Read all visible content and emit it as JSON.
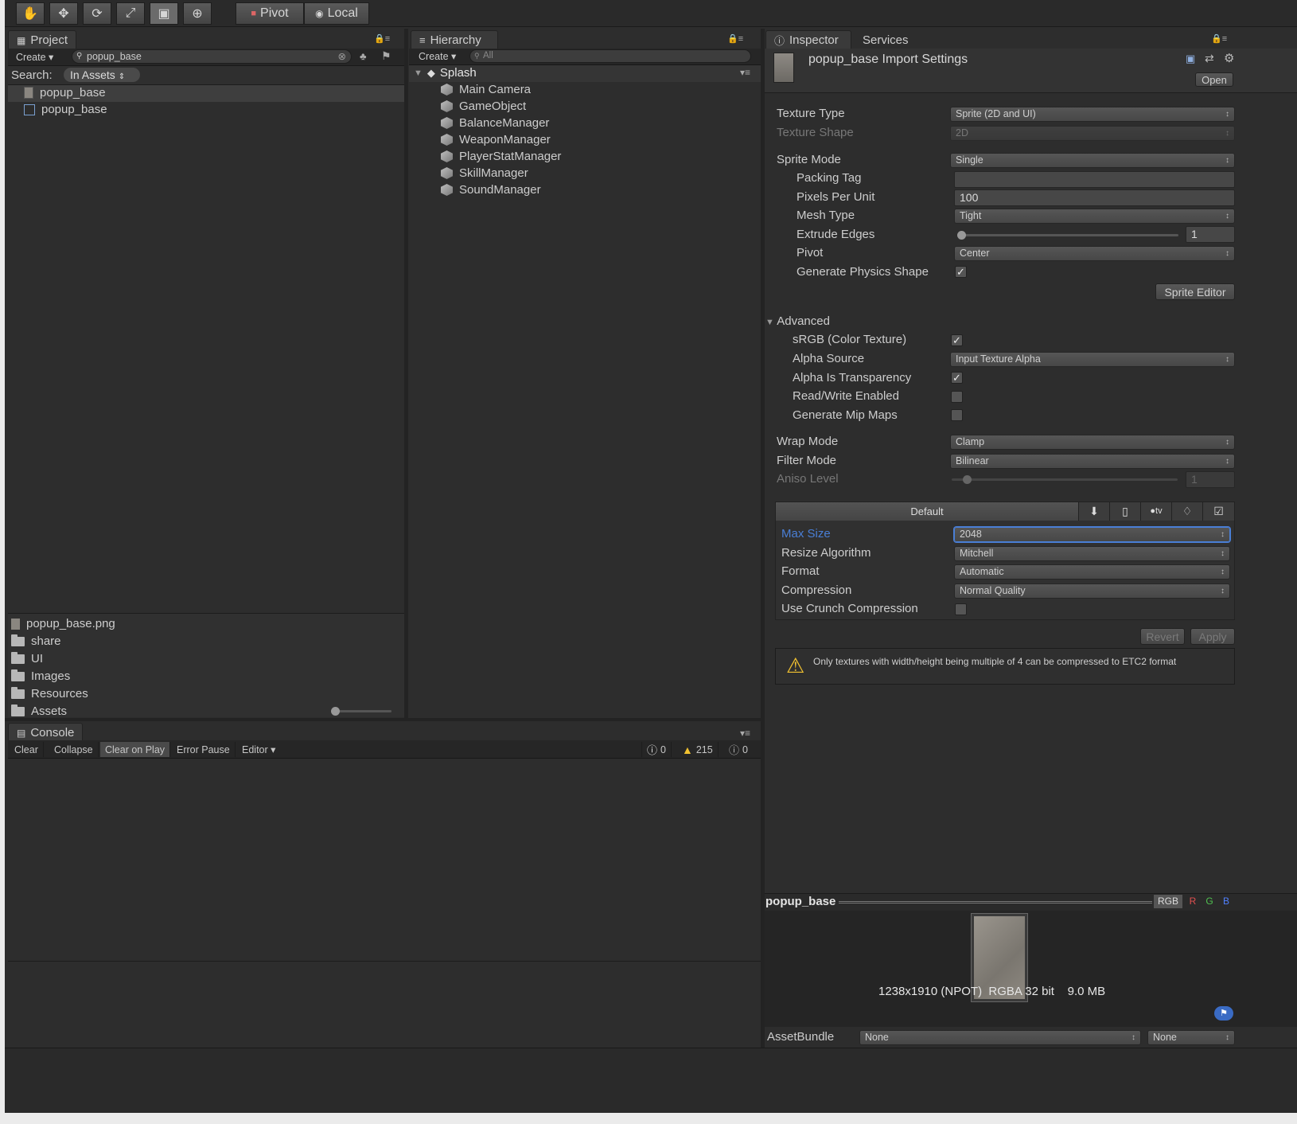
{
  "toolbar": {
    "pivot": "Pivot",
    "local": "Local",
    "tool_icons": [
      "hand-icon",
      "move-icon",
      "rotate-icon",
      "scale-icon",
      "rect-icon",
      "transform-icon"
    ]
  },
  "project": {
    "tab": "Project",
    "create": "Create",
    "search_value": "popup_base",
    "search_label": "Search:",
    "search_scope": "In Assets",
    "results": [
      {
        "name": "popup_base",
        "icon": "texture-icon"
      },
      {
        "name": "popup_base",
        "icon": "sprite-icon"
      }
    ],
    "bottom_items": [
      {
        "name": "popup_base.png",
        "icon": "texture-icon"
      },
      {
        "name": "share",
        "icon": "folder-icon"
      },
      {
        "name": "UI",
        "icon": "folder-icon"
      },
      {
        "name": "Images",
        "icon": "folder-icon"
      },
      {
        "name": "Resources",
        "icon": "folder-icon"
      },
      {
        "name": "Assets",
        "icon": "folder-icon"
      }
    ]
  },
  "hierarchy": {
    "tab": "Hierarchy",
    "create": "Create",
    "search_placeholder": "All",
    "scene": "Splash",
    "objects": [
      "Main Camera",
      "GameObject",
      "BalanceManager",
      "WeaponManager",
      "PlayerStatManager",
      "SkillManager",
      "SoundManager"
    ]
  },
  "inspector": {
    "tab": "Inspector",
    "services_tab": "Services",
    "title": "popup_base Import Settings",
    "open": "Open",
    "texture_type_label": "Texture Type",
    "texture_type": "Sprite (2D and UI)",
    "texture_shape_label": "Texture Shape",
    "texture_shape": "2D",
    "sprite_mode_label": "Sprite Mode",
    "sprite_mode": "Single",
    "packing_tag_label": "Packing Tag",
    "packing_tag": "",
    "ppu_label": "Pixels Per Unit",
    "ppu": "100",
    "mesh_type_label": "Mesh Type",
    "mesh_type": "Tight",
    "extrude_label": "Extrude Edges",
    "extrude": "1",
    "pivot_label": "Pivot",
    "pivot": "Center",
    "physics_label": "Generate Physics Shape",
    "physics": true,
    "sprite_editor": "Sprite Editor",
    "advanced": "Advanced",
    "srgb_label": "sRGB (Color Texture)",
    "srgb": true,
    "alpha_source_label": "Alpha Source",
    "alpha_source": "Input Texture Alpha",
    "alpha_transp_label": "Alpha Is Transparency",
    "alpha_transp": true,
    "rw_label": "Read/Write Enabled",
    "rw": false,
    "mip_label": "Generate Mip Maps",
    "mip": false,
    "wrap_label": "Wrap Mode",
    "wrap": "Clamp",
    "filter_label": "Filter Mode",
    "filter": "Bilinear",
    "aniso_label": "Aniso Level",
    "aniso": "1",
    "platform_default": "Default",
    "platform_icons": [
      "download-icon",
      "phone-icon",
      "appletv-icon",
      "android-icon",
      "html5-icon"
    ],
    "max_size_label": "Max Size",
    "max_size": "2048",
    "resize_label": "Resize Algorithm",
    "resize": "Mitchell",
    "format_label": "Format",
    "format": "Automatic",
    "compression_label": "Compression",
    "compression": "Normal Quality",
    "crunch_label": "Use Crunch Compression",
    "crunch": false,
    "revert": "Revert",
    "apply": "Apply",
    "warning": "Only textures with width/height being multiple of 4 can be compressed to ETC2 format"
  },
  "preview": {
    "name": "popup_base",
    "channels": [
      "RGB",
      "R",
      "G",
      "B"
    ],
    "info": "1238x1910 (NPOT)  RGBA 32 bit    9.0 MB"
  },
  "assetbundle": {
    "label": "AssetBundle",
    "name": "None",
    "variant": "None"
  },
  "console": {
    "tab": "Console",
    "buttons": [
      "Clear",
      "Collapse",
      "Clear on Play",
      "Error Pause",
      "Editor"
    ],
    "errors": "0",
    "warnings": "215",
    "messages": "0"
  },
  "colors": {
    "accent_blue": "#4a7fd6",
    "warning_yellow": "#f2c230",
    "channel_r": "#e05050",
    "channel_g": "#50c050",
    "channel_b": "#5080ff"
  }
}
